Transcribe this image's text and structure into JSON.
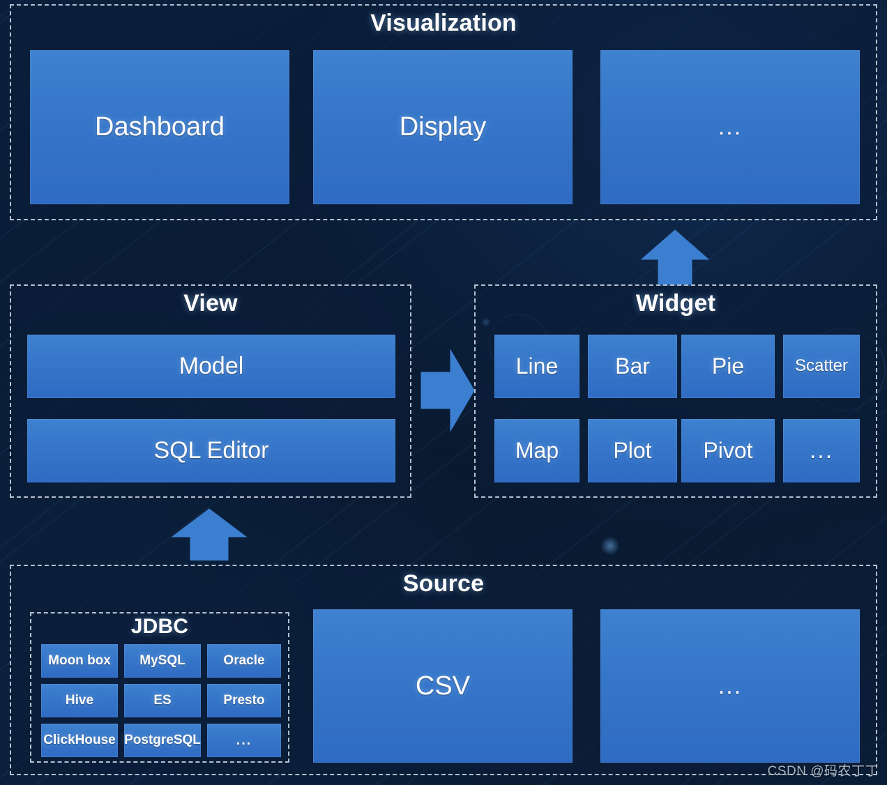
{
  "diagram": {
    "title_hidden": "Data Visualization Platform Architecture",
    "background_color": "#0a1c33",
    "box_color": "#3778ca",
    "border_color": "#b4c0cf",
    "text_color": "#ffffff"
  },
  "visualization": {
    "title": "Visualization",
    "boxes": [
      {
        "label": "Dashboard"
      },
      {
        "label": "Display"
      },
      {
        "label": "..."
      }
    ]
  },
  "view": {
    "title": "View",
    "boxes": [
      {
        "label": "Model"
      },
      {
        "label": "SQL Editor"
      }
    ]
  },
  "widget": {
    "title": "Widget",
    "row1": [
      {
        "label": "Line"
      },
      {
        "label": "Bar"
      },
      {
        "label": "Pie"
      },
      {
        "label": "Scatter"
      }
    ],
    "row2": [
      {
        "label": "Map"
      },
      {
        "label": "Plot"
      },
      {
        "label": "Pivot"
      },
      {
        "label": "..."
      }
    ]
  },
  "source": {
    "title": "Source",
    "jdbc": {
      "title": "JDBC",
      "items": [
        {
          "label": "Moon box"
        },
        {
          "label": "MySQL"
        },
        {
          "label": "Oracle"
        },
        {
          "label": "Hive"
        },
        {
          "label": "ES"
        },
        {
          "label": "Presto"
        },
        {
          "label": "ClickHouse"
        },
        {
          "label": "PostgreSQL"
        },
        {
          "label": "..."
        }
      ]
    },
    "boxes": [
      {
        "label": "CSV"
      },
      {
        "label": "..."
      }
    ]
  },
  "arrows": {
    "widget_to_visualization": {
      "icon": "arrow-up-icon",
      "direction": "up"
    },
    "view_to_widget": {
      "icon": "arrow-right-icon",
      "direction": "right"
    },
    "source_to_view": {
      "icon": "arrow-up-icon",
      "direction": "up"
    }
  },
  "watermark": {
    "text": "CSDN @码农丁丁"
  }
}
